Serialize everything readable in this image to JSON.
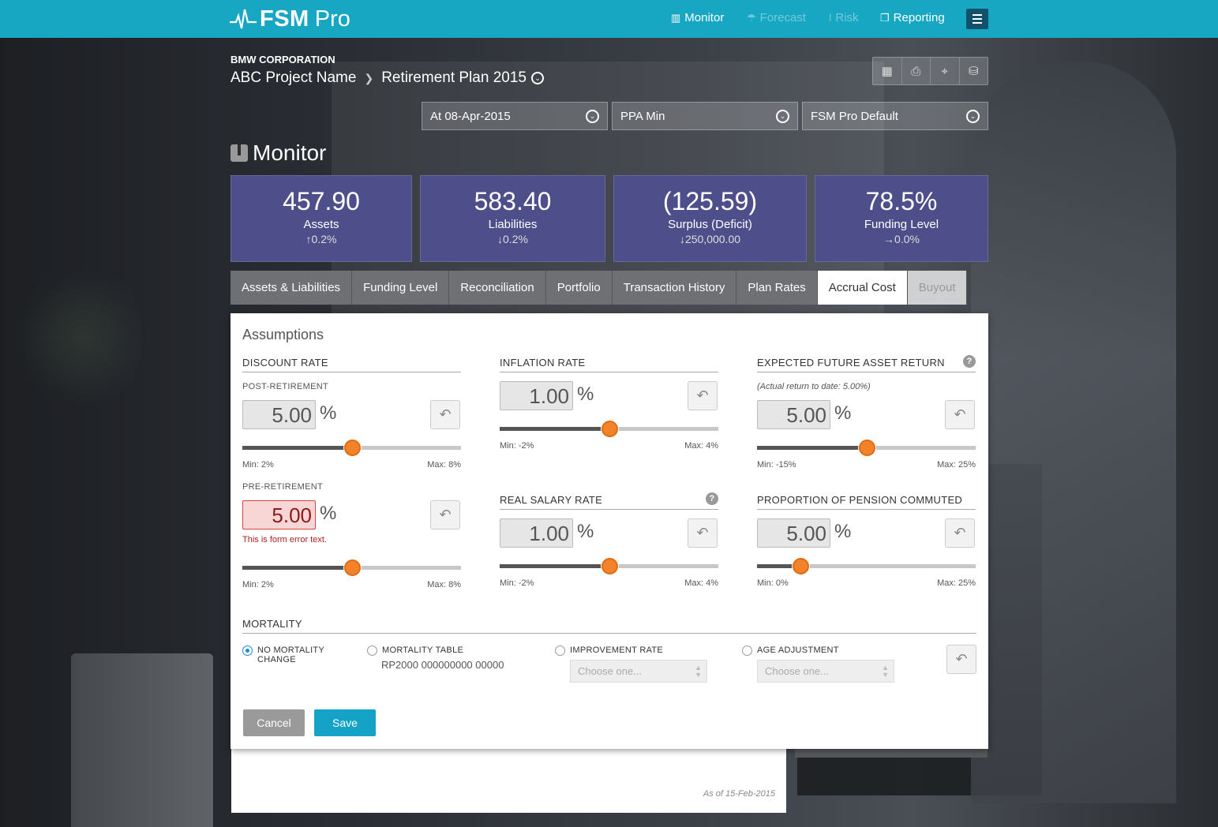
{
  "app": {
    "name_bold": "FSM",
    "name_light": "Pro"
  },
  "nav": [
    {
      "label": "Monitor",
      "icon": "binoculars-icon",
      "enabled": true
    },
    {
      "label": "Forecast",
      "icon": "umbrella-icon",
      "enabled": false
    },
    {
      "label": "Risk",
      "icon": "thermometer-icon",
      "enabled": false
    },
    {
      "label": "Reporting",
      "icon": "copy-icon",
      "enabled": true
    }
  ],
  "header": {
    "company": "BMW CORPORATION",
    "project": "ABC Project Name",
    "plan": "Retirement Plan 2015"
  },
  "toolbar": [
    "excel-icon",
    "print-icon",
    "target-icon",
    "coins-icon"
  ],
  "filters": {
    "date": "At 08-Apr-2015",
    "basis": "PPA Min",
    "profile": "FSM Pro Default"
  },
  "page_title": "Monitor",
  "kpis": [
    {
      "value": "457.90",
      "label": "Assets",
      "change": "↑0.2%"
    },
    {
      "value": "583.40",
      "label": "Liabilities",
      "change": "↓0.2%"
    },
    {
      "value": "(125.59)",
      "label": "Surplus (Deficit)",
      "change": "↓250,000.00"
    },
    {
      "value": "78.5%",
      "label": "Funding Level",
      "change": "→0.0%"
    }
  ],
  "tabs": [
    {
      "label": "Assets & Liabilities",
      "state": "normal"
    },
    {
      "label": "Funding Level",
      "state": "normal"
    },
    {
      "label": "Reconciliation",
      "state": "normal"
    },
    {
      "label": "Portfolio",
      "state": "normal"
    },
    {
      "label": "Transaction History",
      "state": "normal"
    },
    {
      "label": "Plan Rates",
      "state": "normal"
    },
    {
      "label": "Accrual Cost",
      "state": "active"
    },
    {
      "label": "Buyout",
      "state": "disabled"
    }
  ],
  "assumptions": {
    "title": "Assumptions",
    "discount": {
      "heading": "DISCOUNT RATE",
      "post": {
        "label": "POST-RETIREMENT",
        "value": "5.00",
        "unit": "%",
        "min": "Min: 2%",
        "max": "Max: 8%",
        "level": 0.5
      },
      "pre": {
        "label": "PRE-RETIREMENT",
        "value": "5.00",
        "unit": "%",
        "error": "This is form error text.",
        "min": "Min: 2%",
        "max": "Max: 8%",
        "level": 0.5
      }
    },
    "inflation": {
      "heading": "INFLATION RATE",
      "value": "1.00",
      "unit": "%",
      "min": "Min: -2%",
      "max": "Max: 4%",
      "level": 0.5
    },
    "salary": {
      "heading": "REAL SALARY RATE",
      "value": "1.00",
      "unit": "%",
      "min": "Min: -2%",
      "max": "Max: 4%",
      "level": 0.5
    },
    "asset_return": {
      "heading": "EXPECTED FUTURE ASSET RETURN",
      "note": "(Actual return to date: 5.00%)",
      "value": "5.00",
      "unit": "%",
      "min": "Min: -15%",
      "max": "Max: 25%",
      "level": 0.5
    },
    "commuted": {
      "heading": "PROPORTION OF PENSION COMMUTED",
      "value": "5.00",
      "unit": "%",
      "min": "Min: 0%",
      "max": "Max: 25%",
      "level": 0.2
    },
    "mortality": {
      "heading": "MORTALITY",
      "options": [
        {
          "label": "NO MORTALITY CHANGE",
          "line1": "NO MORTALITY",
          "line2": "CHANGE",
          "selected": true
        },
        {
          "label": "MORTALITY TABLE",
          "selected": false,
          "value": "RP2000 000000000 00000"
        },
        {
          "label": "IMPROVEMENT RATE",
          "selected": false,
          "placeholder": "Choose one..."
        },
        {
          "label": "AGE ADJUSTMENT",
          "selected": false,
          "placeholder": "Choose one..."
        }
      ]
    },
    "cancel_label": "Cancel",
    "save_label": "Save"
  },
  "footer_note": "As of 15-Feb-2015",
  "colors": {
    "topbar": "#17a7c2",
    "kpi": "#4e4f8a",
    "knob": "#f2832a",
    "save": "#14a3c7",
    "cancel": "#9a9a9a",
    "error": "#b01e1e"
  }
}
